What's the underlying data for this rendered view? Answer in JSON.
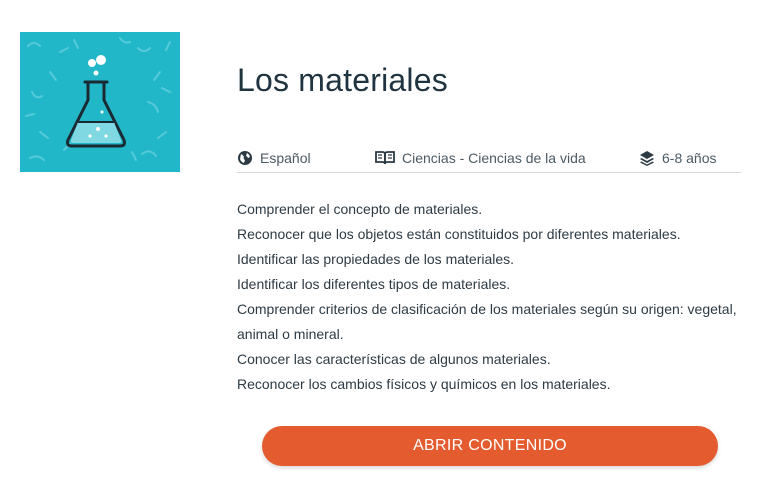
{
  "resource": {
    "title": "Los materiales",
    "thumbnail_icon": "flask-icon",
    "thumbnail_color": "#22b6c9",
    "meta": {
      "language": "Español",
      "language_icon": "globe-icon",
      "subject": "Ciencias - Ciencias de la vida",
      "subject_icon": "book-icon",
      "age": "6-8 años",
      "age_icon": "layers-icon"
    },
    "objectives": [
      "Comprender el concepto de materiales.",
      "Reconocer que los objetos están constituidos por diferentes materiales.",
      "Identificar las propiedades de los materiales.",
      "Identificar los diferentes tipos de materiales.",
      "Comprender criterios de clasificación de los materiales según su origen: vegetal,",
      "animal o mineral.",
      "Conocer las características de algunos materiales.",
      "Reconocer los cambios físicos y químicos en los materiales."
    ],
    "cta_label": "ABRIR CONTENIDO",
    "cta_color": "#e35b2f"
  }
}
